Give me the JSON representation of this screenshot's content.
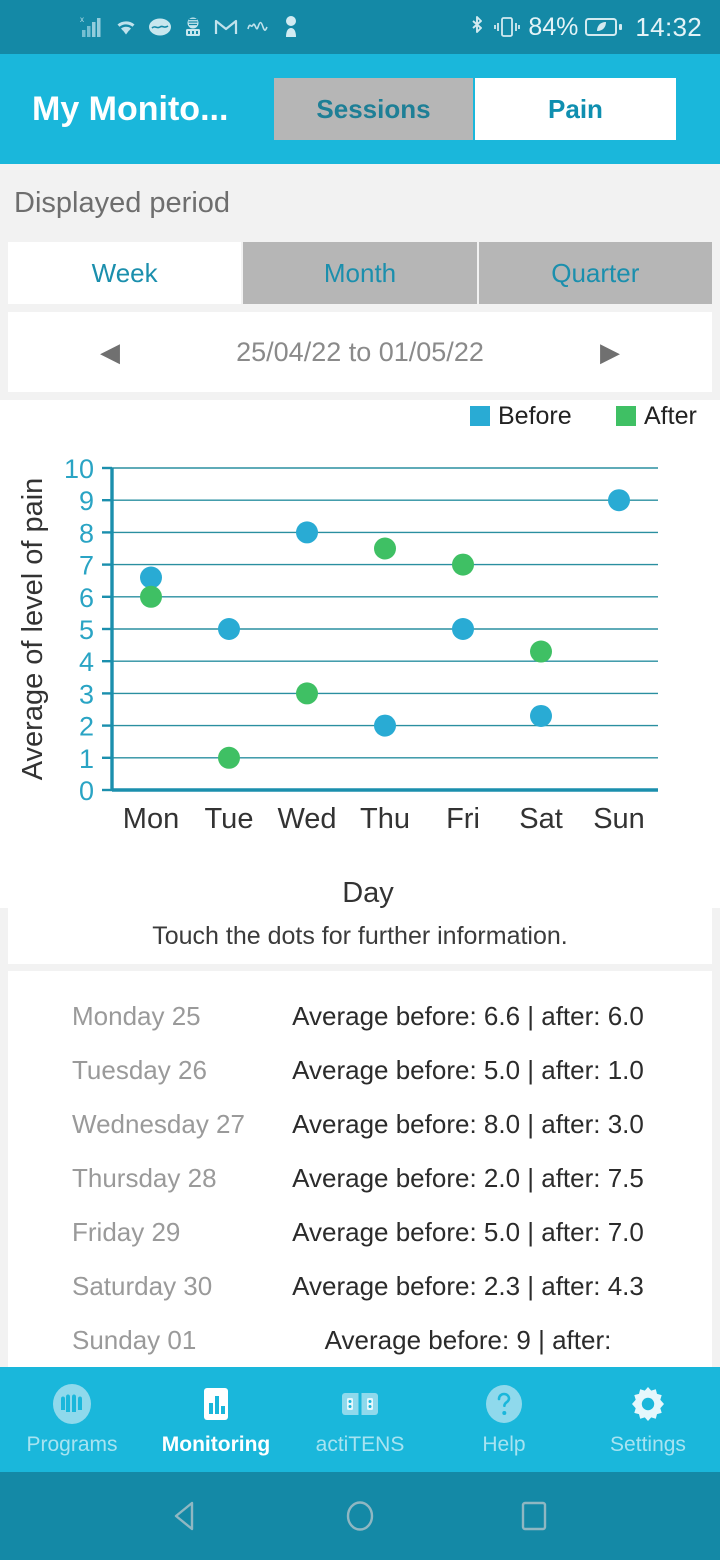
{
  "statusbar": {
    "icons": [
      "signal-bars-icon",
      "wifi-icon",
      "eye-app-icon",
      "microphone-app-icon",
      "gmail-icon",
      "waveform-icon",
      "person-key-icon"
    ],
    "bluetooth": "bluetooth-icon",
    "vibrate": "vibrate-icon",
    "battery_percent": "84%",
    "battery": "battery-icon",
    "time": "14:32"
  },
  "appbar": {
    "title": "My Monito...",
    "tabs": [
      {
        "label": "Sessions",
        "active": false
      },
      {
        "label": "Pain",
        "active": true
      }
    ]
  },
  "period": {
    "heading": "Displayed period",
    "range_tabs": [
      {
        "label": "Week",
        "active": true
      },
      {
        "label": "Month",
        "active": false
      },
      {
        "label": "Quarter",
        "active": false
      }
    ],
    "prev_arrow": "◀",
    "next_arrow": "▶",
    "range": "25/04/22 to 01/05/22"
  },
  "chart_data": {
    "type": "scatter",
    "title": "",
    "xlabel": "Day",
    "ylabel": "Average of level of pain",
    "categories": [
      "Mon",
      "Tue",
      "Wed",
      "Thu",
      "Fri",
      "Sat",
      "Sun"
    ],
    "ylim": [
      0,
      10
    ],
    "yticks": [
      0,
      1,
      2,
      3,
      4,
      5,
      6,
      7,
      8,
      9,
      10
    ],
    "grid": true,
    "legend_position": "top-right",
    "series": [
      {
        "name": "Before",
        "color": "#29abd4",
        "values": [
          6.6,
          5.0,
          8.0,
          2.0,
          5.0,
          2.3,
          9.0
        ]
      },
      {
        "name": "After",
        "color": "#3fc064",
        "values": [
          6.0,
          1.0,
          3.0,
          7.5,
          7.0,
          4.3,
          null
        ]
      }
    ]
  },
  "hint": "Touch the dots for further information.",
  "table": {
    "rows": [
      {
        "day": "Monday 25",
        "value": "Average before: 6.6 | after: 6.0"
      },
      {
        "day": "Tuesday 26",
        "value": "Average before: 5.0 | after: 1.0"
      },
      {
        "day": "Wednesday 27",
        "value": "Average before: 8.0 | after: 3.0"
      },
      {
        "day": "Thursday 28",
        "value": "Average before: 2.0 | after: 7.5"
      },
      {
        "day": "Friday 29",
        "value": "Average before: 5.0 | after: 7.0"
      },
      {
        "day": "Saturday 30",
        "value": "Average before: 2.3 | after: 4.3"
      },
      {
        "day": "Sunday 01",
        "value": "Average before: 9 | after:"
      }
    ]
  },
  "bottomnav": {
    "items": [
      {
        "label": "Programs",
        "icon": "waveform-circle-icon",
        "active": false
      },
      {
        "label": "Monitoring",
        "icon": "bar-chart-icon",
        "active": true
      },
      {
        "label": "actiTENS",
        "icon": "device-icon",
        "active": false
      },
      {
        "label": "Help",
        "icon": "question-mark-icon",
        "active": false
      },
      {
        "label": "Settings",
        "icon": "gear-icon",
        "active": false
      }
    ]
  },
  "androidnav": {
    "back": "back-triangle-icon",
    "home": "home-circle-icon",
    "recents": "recents-square-icon"
  },
  "colors": {
    "accent": "#1ab7db",
    "statusbar": "#1489a6",
    "before": "#29abd4",
    "after": "#3fc064",
    "axis": "#1b8fad"
  }
}
